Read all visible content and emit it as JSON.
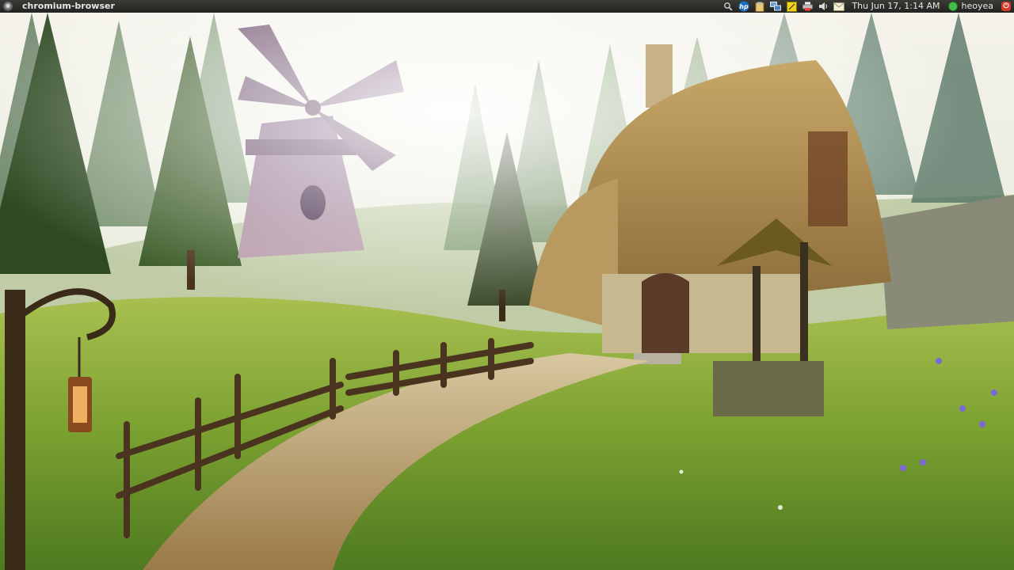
{
  "panel": {
    "app_name": "chromium-browser",
    "clock": "Thu Jun 17,  1:14 AM",
    "username": "heoyea",
    "tray_icons": [
      "search-icon",
      "hp-icon",
      "clipboard-icon",
      "network-icon",
      "notes-icon",
      "printer-icon",
      "volume-icon",
      "mail-icon"
    ],
    "hp_label": "hp"
  },
  "colors": {
    "panel_bg": "#2b2b29",
    "status_online": "#44c046",
    "power": "#d43a2a"
  }
}
